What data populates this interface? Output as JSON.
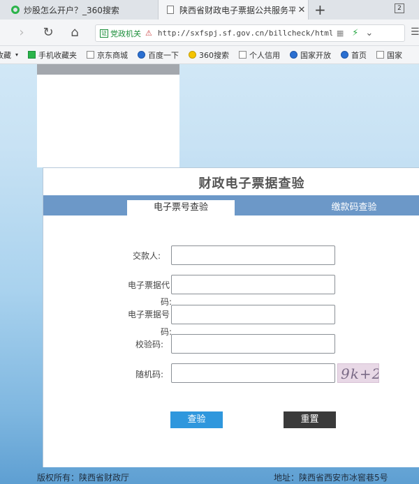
{
  "browser": {
    "tabs": [
      {
        "title": "炒股怎么开户？_360搜索"
      },
      {
        "title": "陕西省财政电子票据公共服务平"
      }
    ],
    "new_tab_symbol": "+",
    "tab_count": "2",
    "cert_label": "党政机关",
    "url": "http://sxfspj.sf.gov.cn/billcheck/html/",
    "bookmarks": [
      "收藏",
      "手机收藏夹",
      "京东商城",
      "百度一下",
      "360搜索",
      "个人信用",
      "国家开放",
      "首页",
      "国家"
    ]
  },
  "form": {
    "title": "财政电子票据查验",
    "tabs": {
      "by_number": "电子票号查验",
      "by_payment_code": "缴款码查验"
    },
    "labels": {
      "payer": "交款人:",
      "bill_code_a": "电子票据代",
      "bill_code_b": "码:",
      "bill_number_a": "电子票据号",
      "bill_number_b": "码:",
      "check_code": "校验码:",
      "random_code": "随机码:"
    },
    "captcha_text": "9k+2",
    "buttons": {
      "check": "查验",
      "reset": "重置"
    }
  },
  "footer": {
    "copyright": "版权所有：陕西省财政厅",
    "address": "地址：陕西省西安市冰窖巷5号"
  }
}
